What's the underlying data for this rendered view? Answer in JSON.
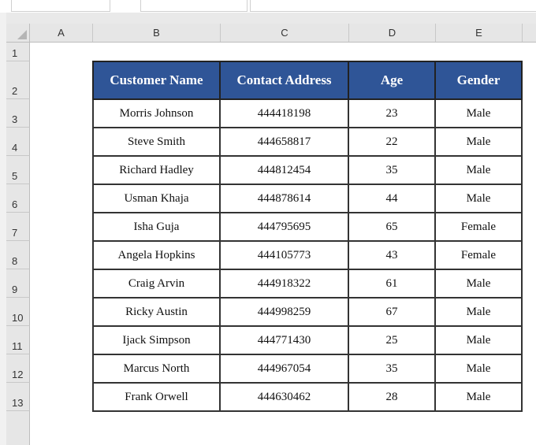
{
  "spreadsheet": {
    "column_headers": [
      "A",
      "B",
      "C",
      "D",
      "E"
    ],
    "row_headers": [
      "1",
      "2",
      "3",
      "4",
      "5",
      "6",
      "7",
      "8",
      "9",
      "10",
      "11",
      "12",
      "13"
    ]
  },
  "table": {
    "headers": [
      "Customer Name",
      "Contact Address",
      "Age",
      "Gender"
    ],
    "rows": [
      [
        "Morris Johnson",
        "444418198",
        "23",
        "Male"
      ],
      [
        "Steve Smith",
        "444658817",
        "22",
        "Male"
      ],
      [
        "Richard Hadley",
        "444812454",
        "35",
        "Male"
      ],
      [
        "Usman Khaja",
        "444878614",
        "44",
        "Male"
      ],
      [
        "Isha Guja",
        "444795695",
        "65",
        "Female"
      ],
      [
        "Angela Hopkins",
        "444105773",
        "43",
        "Female"
      ],
      [
        "Craig Arvin",
        "444918322",
        "61",
        "Male"
      ],
      [
        "Ricky Austin",
        "444998259",
        "67",
        "Male"
      ],
      [
        "Ijack Simpson",
        "444771430",
        "25",
        "Male"
      ],
      [
        "Marcus North",
        "444967054",
        "35",
        "Male"
      ],
      [
        "Frank Orwell",
        "444630462",
        "28",
        "Male"
      ]
    ]
  },
  "colors": {
    "header_fill": "#2f5597",
    "header_text": "#ffffff"
  }
}
